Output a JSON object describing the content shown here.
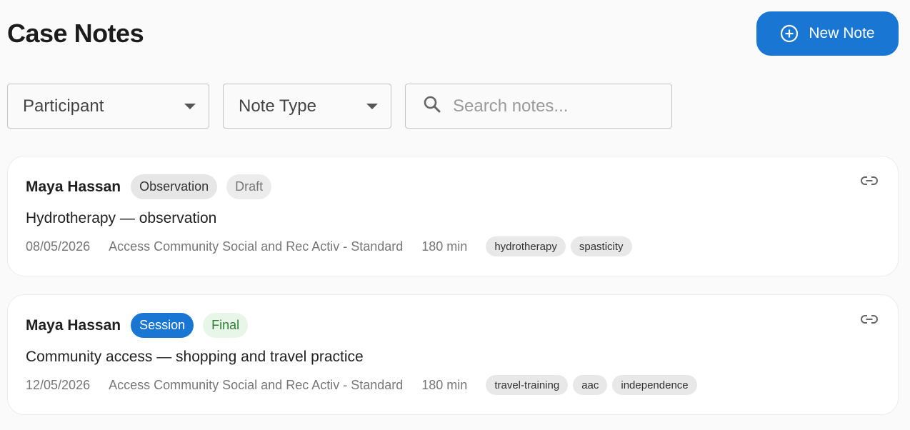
{
  "page": {
    "title": "Case Notes"
  },
  "actions": {
    "new_note_label": "New Note",
    "new_note_icon": "plus-circle-icon"
  },
  "filters": {
    "participant_label": "Participant",
    "note_type_label": "Note Type",
    "search_placeholder": "Search notes..."
  },
  "colors": {
    "accent": "#1976d2",
    "final_text": "#2e7d32",
    "final_bg": "#e8f5e9"
  },
  "notes": [
    {
      "participant": "Maya Hassan",
      "type": "Observation",
      "status": "Draft",
      "title": "Hydrotherapy — observation",
      "date": "08/05/2026",
      "service": "Access Community Social and Rec Activ - Standard",
      "duration": "180 min",
      "tags": [
        "hydrotherapy",
        "spasticity"
      ],
      "icon": "link-icon"
    },
    {
      "participant": "Maya Hassan",
      "type": "Session",
      "status": "Final",
      "title": "Community access — shopping and travel practice",
      "date": "12/05/2026",
      "service": "Access Community Social and Rec Activ - Standard",
      "duration": "180 min",
      "tags": [
        "travel-training",
        "aac",
        "independence"
      ],
      "icon": "link-icon"
    }
  ]
}
